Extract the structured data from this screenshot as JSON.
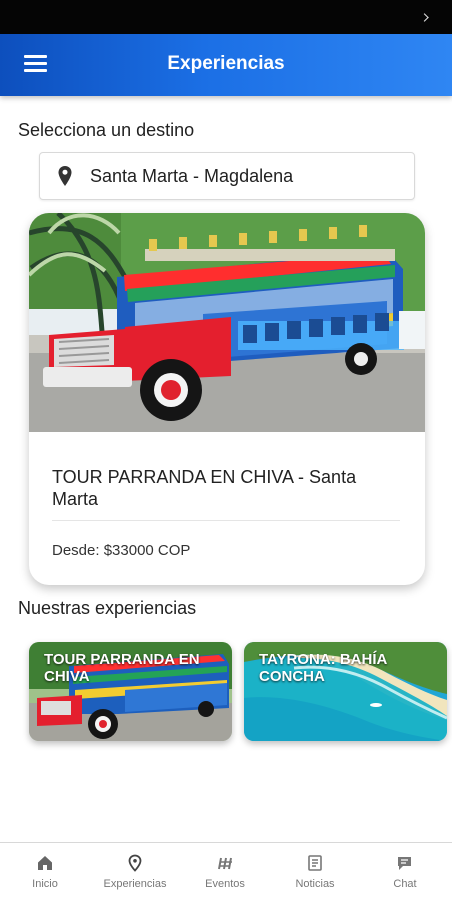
{
  "header": {
    "title": "Experiencias",
    "menu_icon": "menu-icon"
  },
  "destination": {
    "label": "Selecciona un destino",
    "selected": "Santa Marta - Magdalena",
    "icon": "location-pin-icon"
  },
  "featured": {
    "title": "TOUR PARRANDA EN CHIVA - Santa Marta",
    "price": "Desde: $33000 COP"
  },
  "experiences": {
    "label": "Nuestras experiencias",
    "items": [
      {
        "title": "TOUR PARRANDA EN CHIVA"
      },
      {
        "title": "TAYRONA: BAHÍA CONCHA"
      }
    ]
  },
  "nav": {
    "items": [
      {
        "label": "Inicio",
        "icon": "home-icon"
      },
      {
        "label": "Experiencias",
        "icon": "location-pin-icon"
      },
      {
        "label": "Eventos",
        "icon": "events-icon"
      },
      {
        "label": "Noticias",
        "icon": "news-icon"
      },
      {
        "label": "Chat",
        "icon": "chat-icon"
      }
    ]
  },
  "colors": {
    "primary": "#1b6fe5",
    "nav_text": "#777777"
  }
}
